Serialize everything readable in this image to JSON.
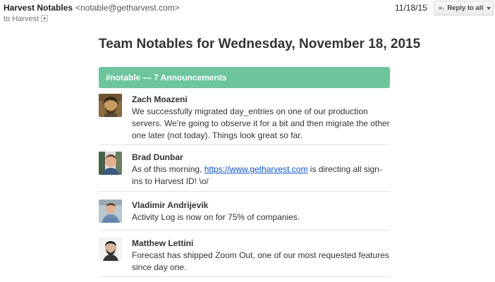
{
  "header": {
    "sender_name": "Harvest Notables",
    "sender_email": "<notable@getharvest.com>",
    "to_label": "to Harvest",
    "date": "11/18/15",
    "reply_label": "Reply to all",
    "icons": [
      "star-icon",
      "reply-all-icon",
      "chevron-down-icon"
    ]
  },
  "email": {
    "title": "Team Notables for Wednesday, November 18, 2015",
    "banner": "#notable — 7 Announcements",
    "banner_color": "#6cc59c",
    "link_color": "#1155cc"
  },
  "entries": [
    {
      "name": "Zach Moazeni",
      "message": "We successfully migrated day_entries on one of our production servers. We're going to observe it for a bit and then migrate the other one later (not today). Things look great so far."
    },
    {
      "name": "Brad Dunbar",
      "message_before": "As of this morning, ",
      "message_link": "https://www.getharvest.com",
      "message_after": " is directing all sign-ins to Harvest ID! \\o/"
    },
    {
      "name": "Vladimir Andrijevik",
      "message": "Activity Log is now on for 75% of companies."
    },
    {
      "name": "Matthew Lettini",
      "message": "Forecast has shipped Zoom Out, one of our most requested features since day one."
    }
  ]
}
